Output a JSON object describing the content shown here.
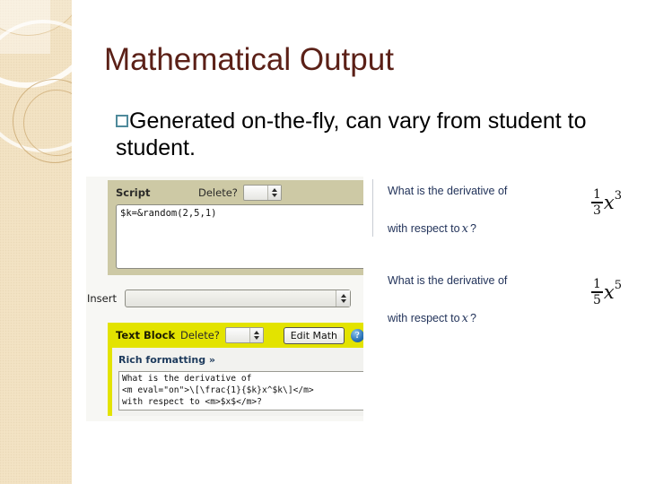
{
  "slide": {
    "title": "Mathematical Output",
    "bullet_text": "Generated on-the-fly, can vary from student to student.",
    "bullet_icon": "hollow-square-bullet",
    "title_color": "#5B2017",
    "bullet_marker_color": "#4F8A9B",
    "sidebar_color": "#F3E3C3"
  },
  "editor": {
    "script_block": {
      "label": "Script",
      "delete_label": "Delete?",
      "delete_value": "",
      "code": "$k=&random(2,5,1)"
    },
    "insert_row": {
      "label": "Insert",
      "value": ""
    },
    "text_block": {
      "label": "Text Block",
      "delete_label": "Delete?",
      "delete_value": "",
      "edit_math_label": "Edit Math",
      "help_icon": "question-mark-icon",
      "help_glyph": "?",
      "rich_formatting_label": "Rich formatting »",
      "source_line_1": "What is the derivative of",
      "source_line_2": "<m eval=\"on\">\\[\\frac{1}{$k}x^$k\\]</m>",
      "source_line_3": "with respect to <m>$x$</m>?",
      "header_color": "#E3E300"
    }
  },
  "questions": [
    {
      "line_1": "What is the derivative of",
      "line_2_prefix": "with respect to",
      "variable": "x",
      "line_2_suffix": "?",
      "math": {
        "numerator": "1",
        "denominator": "3",
        "base": "x",
        "exponent": "3"
      }
    },
    {
      "line_1": "What is the derivative of",
      "line_2_prefix": "with respect to",
      "variable": "x",
      "line_2_suffix": "?",
      "math": {
        "numerator": "1",
        "denominator": "5",
        "base": "x",
        "exponent": "5"
      }
    }
  ]
}
